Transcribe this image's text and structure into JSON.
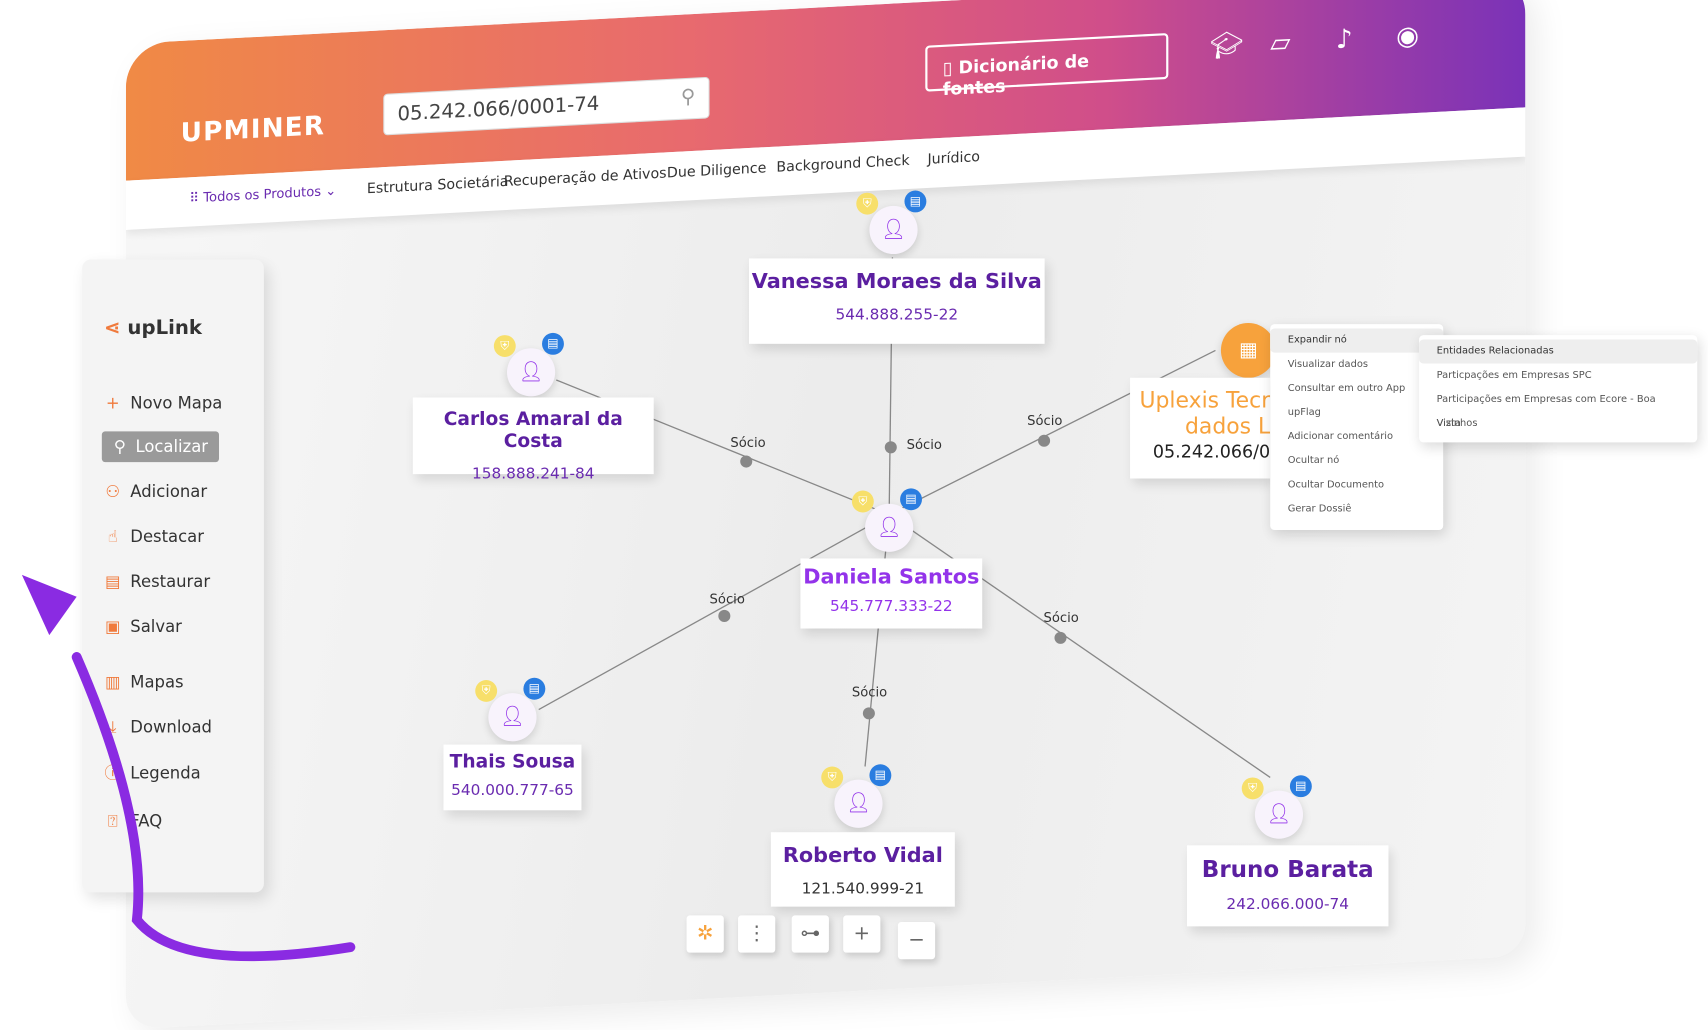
{
  "header": {
    "brand": "UPMINER",
    "search_value": "05.242.066/0001-74",
    "dictionary_button": "Dicionário de fontes",
    "icons": [
      "graduation-cap-icon",
      "clipboard-icon",
      "bell-icon",
      "user-circle-icon"
    ]
  },
  "nav": {
    "products": "Todos os Produtos",
    "items": [
      "Estrutura Societária",
      "Recuperação de Ativos",
      "Due Diligence",
      "Background Check",
      "Jurídico"
    ]
  },
  "sidebar": {
    "title": "upLink",
    "items": [
      {
        "label": "Novo Mapa",
        "icon": "plus-icon"
      },
      {
        "label": "Localizar",
        "icon": "search-icon"
      },
      {
        "label": "Adicionar",
        "icon": "add-user-icon"
      },
      {
        "label": "Destacar",
        "icon": "pointer-icon"
      },
      {
        "label": "Restaurar",
        "icon": "restore-icon"
      },
      {
        "label": "Salvar",
        "icon": "save-icon"
      },
      {
        "label": "Mapas",
        "icon": "map-icon"
      },
      {
        "label": "Download",
        "icon": "download-icon"
      },
      {
        "label": "Legenda",
        "icon": "info-icon"
      },
      {
        "label": "FAQ",
        "icon": "faq-icon"
      }
    ]
  },
  "graph": {
    "nodes": [
      {
        "name": "Vanessa Moraes da Silva",
        "doc": "544.888.255-22"
      },
      {
        "name": "Carlos Amaral da Costa",
        "doc": "158.888.241-84"
      },
      {
        "name": "Daniela Santos",
        "doc": "545.777.333-22"
      },
      {
        "name": "Thais Sousa",
        "doc": "540.000.777-65"
      },
      {
        "name": "Roberto Vidal",
        "doc": "121.540.999-21"
      },
      {
        "name": "Bruno Barata",
        "doc": "242.066.000-74"
      },
      {
        "name_line1": "Uplexis Tecr",
        "name_line2": "dados L",
        "doc": "05.242.066/0"
      }
    ],
    "edge_label": "Sócio"
  },
  "context_menu": {
    "items": [
      "Expandir nó",
      "Visualizar dados",
      "Consultar em outro App",
      "upFlag",
      "Adicionar comentário",
      "Ocultar nó",
      "Ocultar Documento",
      "Gerar Dossiê"
    ],
    "submenu": [
      "Entidades Relacionadas",
      "Particpações em Empresas SPC",
      "Participações em Empresas com Ecore - Boa Vista",
      "Vizinhos"
    ]
  },
  "toolbar": {
    "zoom_in": "+",
    "zoom_out": "−"
  },
  "colors": {
    "accent_purple": "#5b1fa0",
    "orange": "#f08a45"
  }
}
